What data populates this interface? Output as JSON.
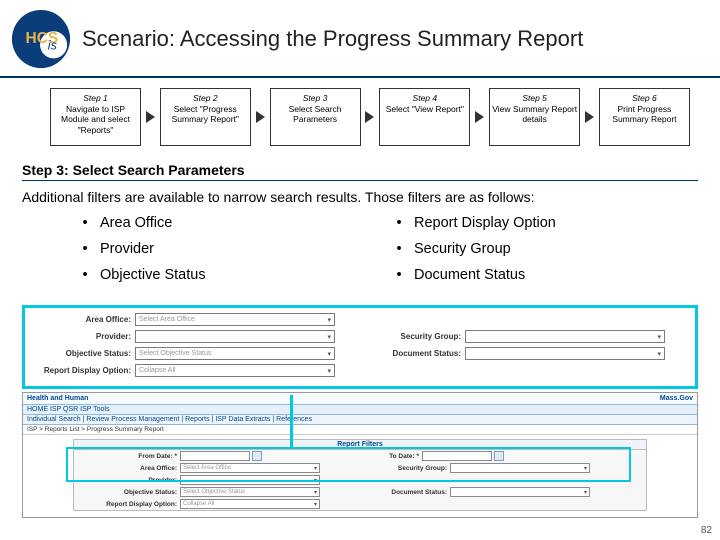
{
  "header": {
    "logo_text_outer": "HCS",
    "logo_text_inner": "is",
    "title": "Scenario: Accessing the Progress Summary Report"
  },
  "flow": [
    {
      "title": "Step 1",
      "body": "Navigate to ISP Module and select \"Reports\""
    },
    {
      "title": "Step 2",
      "body": "Select \"Progress Summary Report\""
    },
    {
      "title": "Step 3",
      "body": "Select Search Parameters"
    },
    {
      "title": "Step 4",
      "body": "Select \"View Report\""
    },
    {
      "title": "Step 5",
      "body": "View Summary Report details"
    },
    {
      "title": "Step 6",
      "body": "Print Progress Summary Report"
    }
  ],
  "section": {
    "heading": "Step 3: Select Search Parameters",
    "intro": "Additional filters are available to narrow search results. Those filters are as follows:"
  },
  "filters_left": [
    "Area Office",
    "Provider",
    "Objective Status"
  ],
  "filters_right": [
    "Report Display Option",
    "Security Group",
    "Document Status"
  ],
  "zoom": {
    "area_office_label": "Area Office:",
    "area_office_value": "Select Area Office",
    "provider_label": "Provider:",
    "security_group_label": "Security Group:",
    "objective_status_label": "Objective Status:",
    "objective_status_value": "Select Objective Status",
    "document_status_label": "Document Status:",
    "report_display_label": "Report Display Option:",
    "report_display_value": "Collapse All"
  },
  "app": {
    "brand_left": "Health and Human",
    "brand_right": "Mass.Gov",
    "nav": "HOME  ISP  QSR  ISP  Tools",
    "sub_nav": "Individual Search | Review Process Management | Reports | ISP Data Extracts | References",
    "breadcrumb": "ISP > Reports List > Progress Summary Report",
    "filters_title": "Report Filters",
    "from_date_label": "From Date: *",
    "to_date_label": "To Date: *",
    "area_office_label": "Area Office:",
    "area_office_value": "Select Area Office",
    "security_group_label": "Security Group:",
    "provider_label": "Provider:",
    "objective_status_label": "Objective Status:",
    "objective_status_value": "Select Objective Status",
    "document_status_label": "Document Status:",
    "report_display_label": "Report Display Option:",
    "report_display_value": "Collapse All"
  },
  "page_number": "82",
  "colors": {
    "highlight": "#00c8e6",
    "brand_navy": "#003366"
  }
}
